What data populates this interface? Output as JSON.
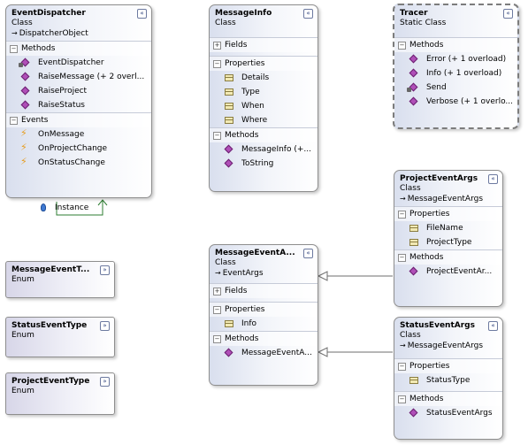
{
  "shapes": {
    "event_dispatcher": {
      "name": "EventDispatcher",
      "kind": "Class",
      "base": "DispatcherObject",
      "toggle": "«",
      "sections": [
        {
          "title": "Methods",
          "expander": "−",
          "items": [
            "EventDispatcher",
            "RaiseMessage (+ 2 overl...",
            "RaiseProject",
            "RaiseStatus"
          ]
        },
        {
          "title": "Events",
          "expander": "−",
          "items": [
            "OnMessage",
            "OnProjectChange",
            "OnStatusChange"
          ]
        }
      ]
    },
    "message_info": {
      "name": "MessageInfo",
      "kind": "Class",
      "toggle": "«",
      "sections": [
        {
          "title": "Fields",
          "expander": "+",
          "items": []
        },
        {
          "title": "Properties",
          "expander": "−",
          "items": [
            "Details",
            "Type",
            "When",
            "Where"
          ]
        },
        {
          "title": "Methods",
          "expander": "−",
          "items": [
            "MessageInfo (+...",
            "ToString"
          ]
        }
      ]
    },
    "tracer": {
      "name": "Tracer",
      "kind": "Static Class",
      "toggle": "«",
      "sections": [
        {
          "title": "Methods",
          "expander": "−",
          "items": [
            "Error (+ 1 overload)",
            "Info (+ 1 overload)",
            "Send",
            "Verbose (+ 1 overlo..."
          ]
        }
      ]
    },
    "project_event_args": {
      "name": "ProjectEventArgs",
      "kind": "Class",
      "base": "MessageEventArgs",
      "toggle": "«",
      "sections": [
        {
          "title": "Properties",
          "expander": "−",
          "items": [
            "FileName",
            "ProjectType"
          ]
        },
        {
          "title": "Methods",
          "expander": "−",
          "items": [
            "ProjectEventAr..."
          ]
        }
      ]
    },
    "message_event_args": {
      "name": "MessageEventA...",
      "kind": "Class",
      "base": "EventArgs",
      "toggle": "«",
      "sections": [
        {
          "title": "Fields",
          "expander": "+",
          "items": []
        },
        {
          "title": "Properties",
          "expander": "−",
          "items": [
            "Info"
          ]
        },
        {
          "title": "Methods",
          "expander": "−",
          "items": [
            "MessageEventA..."
          ]
        }
      ]
    },
    "status_event_args": {
      "name": "StatusEventArgs",
      "kind": "Class",
      "base": "MessageEventArgs",
      "toggle": "«",
      "sections": [
        {
          "title": "Properties",
          "expander": "−",
          "items": [
            "StatusType"
          ]
        },
        {
          "title": "Methods",
          "expander": "−",
          "items": [
            "StatusEventArgs"
          ]
        }
      ]
    },
    "message_event_type": {
      "name": "MessageEventT...",
      "kind": "Enum",
      "toggle": "»"
    },
    "status_event_type": {
      "name": "StatusEventType",
      "kind": "Enum",
      "toggle": "»"
    },
    "project_event_type": {
      "name": "ProjectEventType",
      "kind": "Enum",
      "toggle": "»"
    }
  },
  "association": {
    "label": "Instance"
  },
  "base_arrow_glyph": "→",
  "colors": {
    "inheritance_line": "#6e6e6e",
    "association_line": "#2e7d32"
  }
}
